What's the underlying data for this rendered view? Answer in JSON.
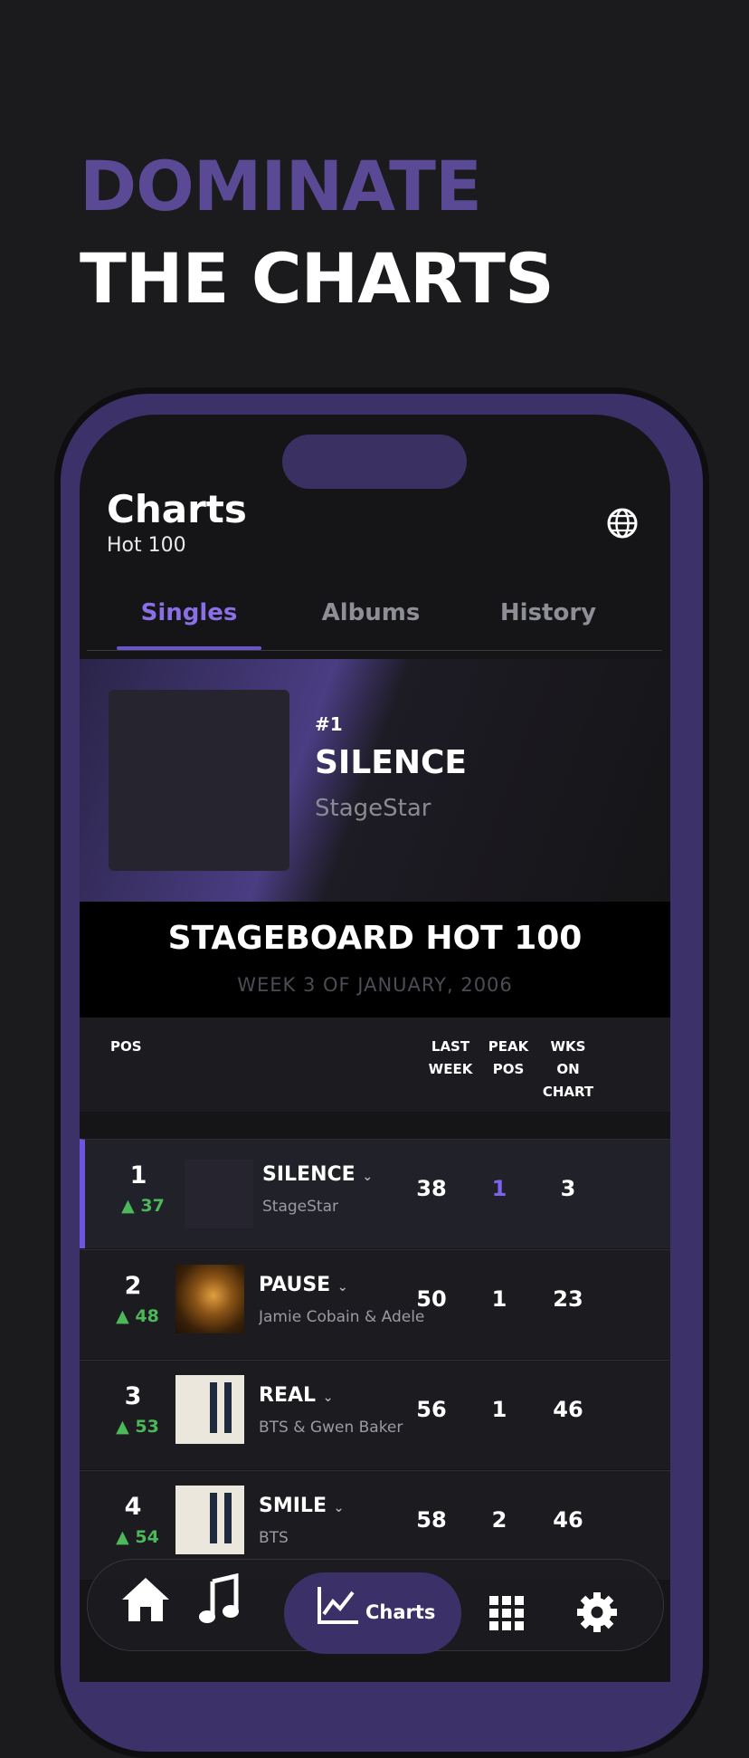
{
  "promo": {
    "line1": "DOMINATE",
    "line2": "THE CHARTS"
  },
  "header": {
    "title": "Charts",
    "subtitle": "Hot 100"
  },
  "tabs": [
    {
      "label": "Singles",
      "active": true
    },
    {
      "label": "Albums",
      "active": false
    },
    {
      "label": "History",
      "active": false
    }
  ],
  "featured": {
    "rank": "#1",
    "title": "SILENCE",
    "artist": "StageStar"
  },
  "board": {
    "title": "STAGEBOARD HOT 100",
    "week": "WEEK 3 OF JANUARY, 2006"
  },
  "columns": {
    "pos": "POS",
    "last_week": [
      "LAST",
      "WEEK"
    ],
    "peak": [
      "PEAK",
      "POS"
    ],
    "weeks": [
      "WKS",
      "ON",
      "CHART"
    ]
  },
  "rows": [
    {
      "pos": "1",
      "move": "37",
      "title": "SILENCE",
      "artist": "StageStar",
      "last": "38",
      "peak": "1",
      "weeks": "3"
    },
    {
      "pos": "2",
      "move": "48",
      "title": "PAUSE",
      "artist": "Jamie Cobain & Adele",
      "last": "50",
      "peak": "1",
      "weeks": "23"
    },
    {
      "pos": "3",
      "move": "53",
      "title": "REAL",
      "artist": "BTS & Gwen Baker",
      "last": "56",
      "peak": "1",
      "weeks": "46"
    },
    {
      "pos": "4",
      "move": "54",
      "title": "SMILE",
      "artist": "BTS",
      "last": "58",
      "peak": "2",
      "weeks": "46"
    }
  ],
  "nav": {
    "charts_label": "Charts"
  },
  "colors": {
    "accent": "#7e63ee",
    "up": "#4cb85a",
    "brand_purple": "#5a4a96"
  }
}
